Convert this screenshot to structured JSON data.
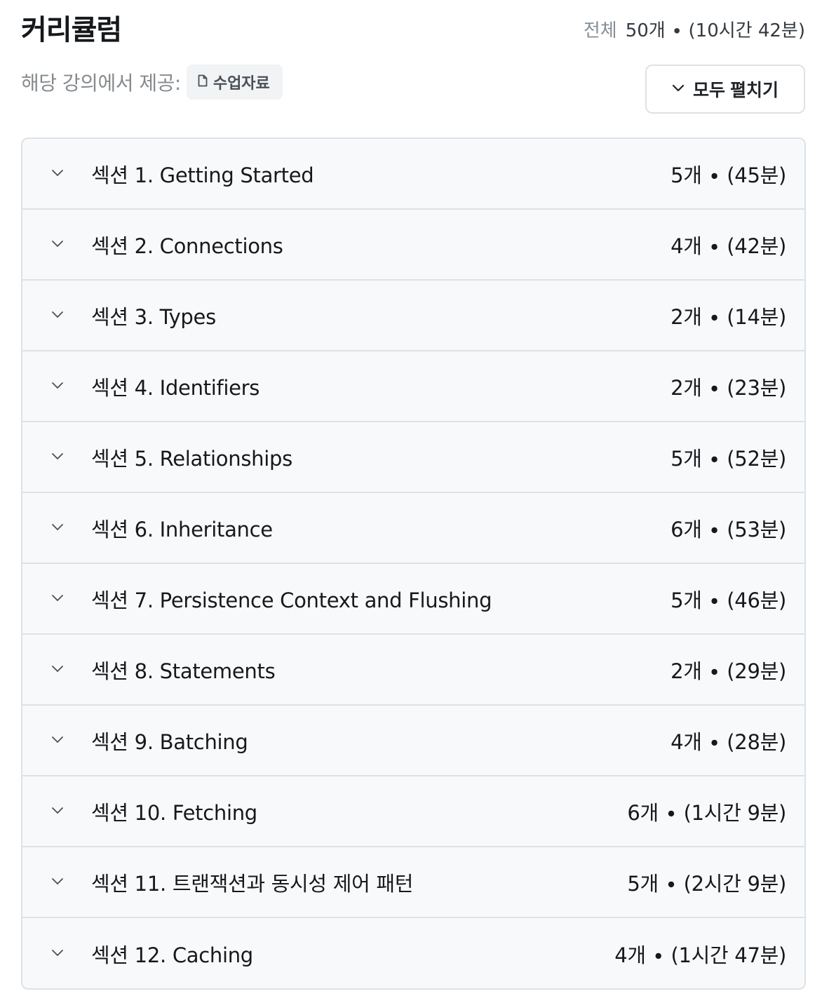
{
  "header": {
    "title": "커리큘럼",
    "total_label": "전체",
    "total_value": "50개 ∙ (10시간 42분)"
  },
  "provide": {
    "label": "해당 강의에서 제공:",
    "resource_label": "수업자료",
    "resource_icon": "file-icon"
  },
  "expand_button": {
    "label": "모두 펼치기",
    "icon": "chevron-down-icon"
  },
  "sections": [
    {
      "title": "섹션 1. Getting Started",
      "meta": "5개 ∙ (45분)"
    },
    {
      "title": "섹션 2. Connections",
      "meta": "4개 ∙ (42분)"
    },
    {
      "title": "섹션 3. Types",
      "meta": "2개 ∙ (14분)"
    },
    {
      "title": "섹션 4. Identifiers",
      "meta": "2개 ∙ (23분)"
    },
    {
      "title": "섹션 5. Relationships",
      "meta": "5개 ∙ (52분)"
    },
    {
      "title": "섹션 6. Inheritance",
      "meta": "6개 ∙ (53분)"
    },
    {
      "title": "섹션 7. Persistence Context and Flushing",
      "meta": "5개 ∙ (46분)"
    },
    {
      "title": "섹션 8. Statements",
      "meta": "2개 ∙ (29분)"
    },
    {
      "title": "섹션 9. Batching",
      "meta": "4개 ∙ (28분)"
    },
    {
      "title": "섹션 10. Fetching",
      "meta": "6개 ∙ (1시간 9분)"
    },
    {
      "title": "섹션 11. 트랜잭션과 동시성 제어 패턴",
      "meta": "5개 ∙ (2시간 9분)"
    },
    {
      "title": "섹션 12. Caching",
      "meta": "4개 ∙ (1시간 47분)"
    }
  ]
}
